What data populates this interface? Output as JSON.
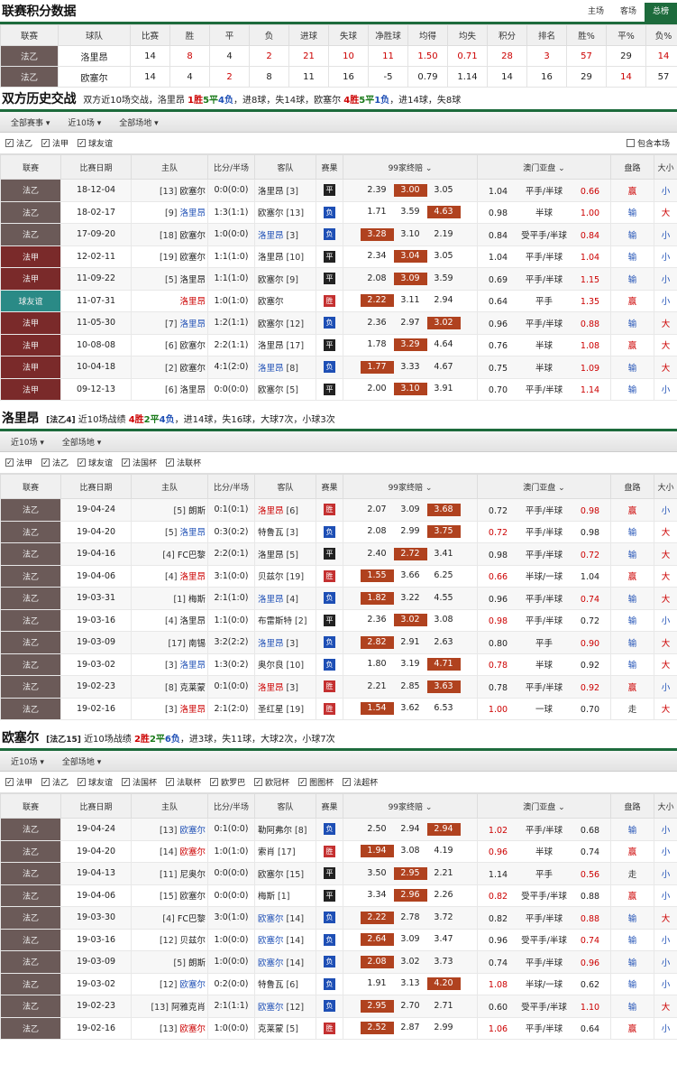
{
  "standings": {
    "title": "联赛积分数据",
    "tabs": [
      "主场",
      "客场",
      "总榜"
    ],
    "headers": [
      "联赛",
      "球队",
      "比赛",
      "胜",
      "平",
      "负",
      "进球",
      "失球",
      "净胜球",
      "均得",
      "均失",
      "积分",
      "排名",
      "胜%",
      "平%",
      "负%"
    ],
    "rows": [
      [
        "法乙",
        "洛里昂",
        "14",
        "8",
        "4",
        "2",
        "21",
        "10",
        "11",
        "1.50",
        "0.71",
        "28",
        "3",
        "57",
        "29",
        "14"
      ],
      [
        "法乙",
        "欧塞尔",
        "14",
        "4",
        "2",
        "8",
        "11",
        "16",
        "-5",
        "0.79",
        "1.14",
        "14",
        "16",
        "29",
        "14",
        "57"
      ]
    ]
  },
  "h2h": {
    "title": "双方历史交战",
    "sub_pre": "双方近10场交战，洛里昂 ",
    "w": "1胜",
    "d": "5平",
    "l": "4负",
    "sub_mid": "，进8球，失14球，欧塞尔 ",
    "w2": "4胜",
    "d2": "5平",
    "l2": "1负",
    "sub_post": "，进14球，失8球",
    "filters": [
      "全部赛事",
      "近10场",
      "全部场地"
    ],
    "checks": [
      "法乙",
      "法甲",
      "球友谊"
    ],
    "right_check": "包含本场",
    "rows": [
      [
        "法乙",
        "fy",
        "18-12-04",
        "[13]",
        "欧塞尔",
        "0:0(0:0)",
        "洛里昂",
        "[3]",
        "平",
        "d",
        "2.39",
        "3.00",
        "3.05",
        1,
        "1.04",
        "平手/半球",
        "0.66",
        "赢",
        "小"
      ],
      [
        "法乙",
        "fy",
        "18-02-17",
        "[9]",
        "洛里昂",
        "1:3(1:1)",
        "欧塞尔",
        "[13]",
        "负",
        "l",
        "1.71",
        "3.59",
        "4.63",
        2,
        "0.98",
        "半球",
        "1.00",
        "输",
        "大"
      ],
      [
        "法乙",
        "fy",
        "17-09-20",
        "[18]",
        "欧塞尔",
        "1:0(0:0)",
        "洛里昂",
        "[3]",
        "负",
        "l",
        "3.28",
        "3.10",
        "2.19",
        0,
        "0.84",
        "受平手/半球",
        "0.84",
        "输",
        "小"
      ],
      [
        "法甲",
        "fj",
        "12-02-11",
        "[19]",
        "欧塞尔",
        "1:1(1:0)",
        "洛里昂",
        "[10]",
        "平",
        "d",
        "2.34",
        "3.04",
        "3.05",
        1,
        "1.04",
        "平手/半球",
        "1.04",
        "输",
        "小"
      ],
      [
        "法甲",
        "fj",
        "11-09-22",
        "[5]",
        "洛里昂",
        "1:1(1:0)",
        "欧塞尔",
        "[9]",
        "平",
        "d",
        "2.08",
        "3.09",
        "3.59",
        1,
        "0.69",
        "平手/半球",
        "1.15",
        "输",
        "小"
      ],
      [
        "球友谊",
        "yq",
        "11-07-31",
        "",
        "洛里昂",
        "1:0(1:0)",
        "欧塞尔",
        "",
        "胜",
        "w",
        "2.22",
        "3.11",
        "2.94",
        0,
        "0.64",
        "平手",
        "1.35",
        "赢",
        "小"
      ],
      [
        "法甲",
        "fj",
        "11-05-30",
        "[7]",
        "洛里昂",
        "1:2(1:1)",
        "欧塞尔",
        "[12]",
        "负",
        "l",
        "2.36",
        "2.97",
        "3.02",
        2,
        "0.96",
        "平手/半球",
        "0.88",
        "输",
        "大"
      ],
      [
        "法甲",
        "fj",
        "10-08-08",
        "[6]",
        "欧塞尔",
        "2:2(1:1)",
        "洛里昂",
        "[17]",
        "平",
        "d",
        "1.78",
        "3.29",
        "4.64",
        1,
        "0.76",
        "半球",
        "1.08",
        "赢",
        "大"
      ],
      [
        "法甲",
        "fj",
        "10-04-18",
        "[2]",
        "欧塞尔",
        "4:1(2:0)",
        "洛里昂",
        "[8]",
        "负",
        "l",
        "1.77",
        "3.33",
        "4.67",
        0,
        "0.75",
        "半球",
        "1.09",
        "输",
        "大"
      ],
      [
        "法甲",
        "fj",
        "09-12-13",
        "[6]",
        "洛里昂",
        "0:0(0:0)",
        "欧塞尔",
        "[5]",
        "平",
        "d",
        "2.00",
        "3.10",
        "3.91",
        1,
        "0.70",
        "平手/半球",
        "1.14",
        "输",
        "小"
      ]
    ],
    "blue": "洛里昂"
  },
  "table_headers": [
    "联赛",
    "比赛日期",
    "主队",
    "比分/半场",
    "客队",
    "赛果",
    "99家终赔",
    "澳门亚盘",
    "盘路",
    "大小"
  ],
  "lorient": {
    "title": "洛里昂",
    "tag": "[法乙4]",
    "sub_pre": "近10场战绩 ",
    "w": "4胜",
    "d": "2平",
    "l": "4负",
    "sub_post": "，进14球，失16球，大球7次，小球3次",
    "filters": [
      "近10场",
      "全部场地"
    ],
    "checks": [
      "法甲",
      "法乙",
      "球友谊",
      "法国杯",
      "法联杯"
    ],
    "blue": "洛里昂",
    "rows": [
      [
        "法乙",
        "fy",
        "19-04-24",
        "[5]",
        "朗斯",
        "0:1(0:1)",
        "洛里昂",
        "[6]",
        "胜",
        "w",
        "2.07",
        "3.09",
        "3.68",
        2,
        "0.72",
        "平手/半球",
        "0.98",
        "赢",
        "小"
      ],
      [
        "法乙",
        "fy",
        "19-04-20",
        "[5]",
        "洛里昂",
        "0:3(0:2)",
        "特鲁瓦",
        "[3]",
        "负",
        "l",
        "2.08",
        "2.99",
        "3.75",
        2,
        "0.72",
        "平手/半球",
        "0.98",
        "输",
        "大"
      ],
      [
        "法乙",
        "fy",
        "19-04-16",
        "[4]",
        "FC巴黎",
        "2:2(0:1)",
        "洛里昂",
        "[5]",
        "平",
        "d",
        "2.40",
        "2.72",
        "3.41",
        1,
        "0.98",
        "平手/半球",
        "0.72",
        "输",
        "大"
      ],
      [
        "法乙",
        "fy",
        "19-04-06",
        "[4]",
        "洛里昂",
        "3:1(0:0)",
        "贝兹尔",
        "[19]",
        "胜",
        "w",
        "1.55",
        "3.66",
        "6.25",
        0,
        "0.66",
        "半球/一球",
        "1.04",
        "赢",
        "大"
      ],
      [
        "法乙",
        "fy",
        "19-03-31",
        "[1]",
        "梅斯",
        "2:1(1:0)",
        "洛里昂",
        "[4]",
        "负",
        "l",
        "1.82",
        "3.22",
        "4.55",
        0,
        "0.96",
        "平手/半球",
        "0.74",
        "输",
        "大"
      ],
      [
        "法乙",
        "fy",
        "19-03-16",
        "[4]",
        "洛里昂",
        "1:1(0:0)",
        "布雷斯特",
        "[2]",
        "平",
        "d",
        "2.36",
        "3.02",
        "3.08",
        1,
        "0.98",
        "平手/半球",
        "0.72",
        "输",
        "小"
      ],
      [
        "法乙",
        "fy",
        "19-03-09",
        "[17]",
        "南锡",
        "3:2(2:2)",
        "洛里昂",
        "[3]",
        "负",
        "l",
        "2.82",
        "2.91",
        "2.63",
        0,
        "0.80",
        "平手",
        "0.90",
        "输",
        "大"
      ],
      [
        "法乙",
        "fy",
        "19-03-02",
        "[3]",
        "洛里昂",
        "1:3(0:2)",
        "奥尔良",
        "[10]",
        "负",
        "l",
        "1.80",
        "3.19",
        "4.71",
        2,
        "0.78",
        "半球",
        "0.92",
        "输",
        "大"
      ],
      [
        "法乙",
        "fy",
        "19-02-23",
        "[8]",
        "克莱蒙",
        "0:1(0:0)",
        "洛里昂",
        "[3]",
        "胜",
        "w",
        "2.21",
        "2.85",
        "3.63",
        2,
        "0.78",
        "平手/半球",
        "0.92",
        "赢",
        "小"
      ],
      [
        "法乙",
        "fy",
        "19-02-16",
        "[3]",
        "洛里昂",
        "2:1(2:0)",
        "圣红星",
        "[19]",
        "胜",
        "w",
        "1.54",
        "3.62",
        "6.53",
        0,
        "1.00",
        "一球",
        "0.70",
        "走",
        "大"
      ]
    ]
  },
  "auxerre": {
    "title": "欧塞尔",
    "tag": "[法乙15]",
    "sub_pre": "近10场战绩 ",
    "w": "2胜",
    "d": "2平",
    "l": "6负",
    "sub_post": "，进3球，失11球，大球2次，小球7次",
    "filters": [
      "近10场",
      "全部场地"
    ],
    "checks": [
      "法甲",
      "法乙",
      "球友谊",
      "法国杯",
      "法联杯",
      "欧罗巴",
      "欧冠杯",
      "图图杯",
      "法超杯"
    ],
    "blue": "欧塞尔",
    "rows": [
      [
        "法乙",
        "fy",
        "19-04-24",
        "[13]",
        "欧塞尔",
        "0:1(0:0)",
        "勒阿弗尔",
        "[8]",
        "负",
        "l",
        "2.50",
        "2.94",
        "2.94",
        2,
        "1.02",
        "平手/半球",
        "0.68",
        "输",
        "小"
      ],
      [
        "法乙",
        "fy",
        "19-04-20",
        "[14]",
        "欧塞尔",
        "1:0(1:0)",
        "索肖",
        "[17]",
        "胜",
        "w",
        "1.94",
        "3.08",
        "4.19",
        0,
        "0.96",
        "半球",
        "0.74",
        "赢",
        "小"
      ],
      [
        "法乙",
        "fy",
        "19-04-13",
        "[11]",
        "尼奥尔",
        "0:0(0:0)",
        "欧塞尔",
        "[15]",
        "平",
        "d",
        "3.50",
        "2.95",
        "2.21",
        1,
        "1.14",
        "平手",
        "0.56",
        "走",
        "小"
      ],
      [
        "法乙",
        "fy",
        "19-04-06",
        "[15]",
        "欧塞尔",
        "0:0(0:0)",
        "梅斯",
        "[1]",
        "平",
        "d",
        "3.34",
        "2.96",
        "2.26",
        1,
        "0.82",
        "受平手/半球",
        "0.88",
        "赢",
        "小"
      ],
      [
        "法乙",
        "fy",
        "19-03-30",
        "[4]",
        "FC巴黎",
        "3:0(1:0)",
        "欧塞尔",
        "[14]",
        "负",
        "l",
        "2.22",
        "2.78",
        "3.72",
        0,
        "0.82",
        "平手/半球",
        "0.88",
        "输",
        "大"
      ],
      [
        "法乙",
        "fy",
        "19-03-16",
        "[12]",
        "贝兹尔",
        "1:0(0:0)",
        "欧塞尔",
        "[14]",
        "负",
        "l",
        "2.64",
        "3.09",
        "3.47",
        0,
        "0.96",
        "受平手/半球",
        "0.74",
        "输",
        "小"
      ],
      [
        "法乙",
        "fy",
        "19-03-09",
        "[5]",
        "朗斯",
        "1:0(0:0)",
        "欧塞尔",
        "[14]",
        "负",
        "l",
        "2.08",
        "3.02",
        "3.73",
        0,
        "0.74",
        "平手/半球",
        "0.96",
        "输",
        "小"
      ],
      [
        "法乙",
        "fy",
        "19-03-02",
        "[12]",
        "欧塞尔",
        "0:2(0:0)",
        "特鲁瓦",
        "[6]",
        "负",
        "l",
        "1.91",
        "3.13",
        "4.20",
        2,
        "1.08",
        "半球/一球",
        "0.62",
        "输",
        "小"
      ],
      [
        "法乙",
        "fy",
        "19-02-23",
        "[13]",
        "阿雅克肖",
        "2:1(1:1)",
        "欧塞尔",
        "[12]",
        "负",
        "l",
        "2.95",
        "2.70",
        "2.71",
        0,
        "0.60",
        "受平手/半球",
        "1.10",
        "输",
        "大"
      ],
      [
        "法乙",
        "fy",
        "19-02-16",
        "[13]",
        "欧塞尔",
        "1:0(0:0)",
        "克莱蒙",
        "[5]",
        "胜",
        "w",
        "2.52",
        "2.87",
        "2.99",
        0,
        "1.06",
        "平手/半球",
        "0.64",
        "赢",
        "小"
      ]
    ]
  }
}
